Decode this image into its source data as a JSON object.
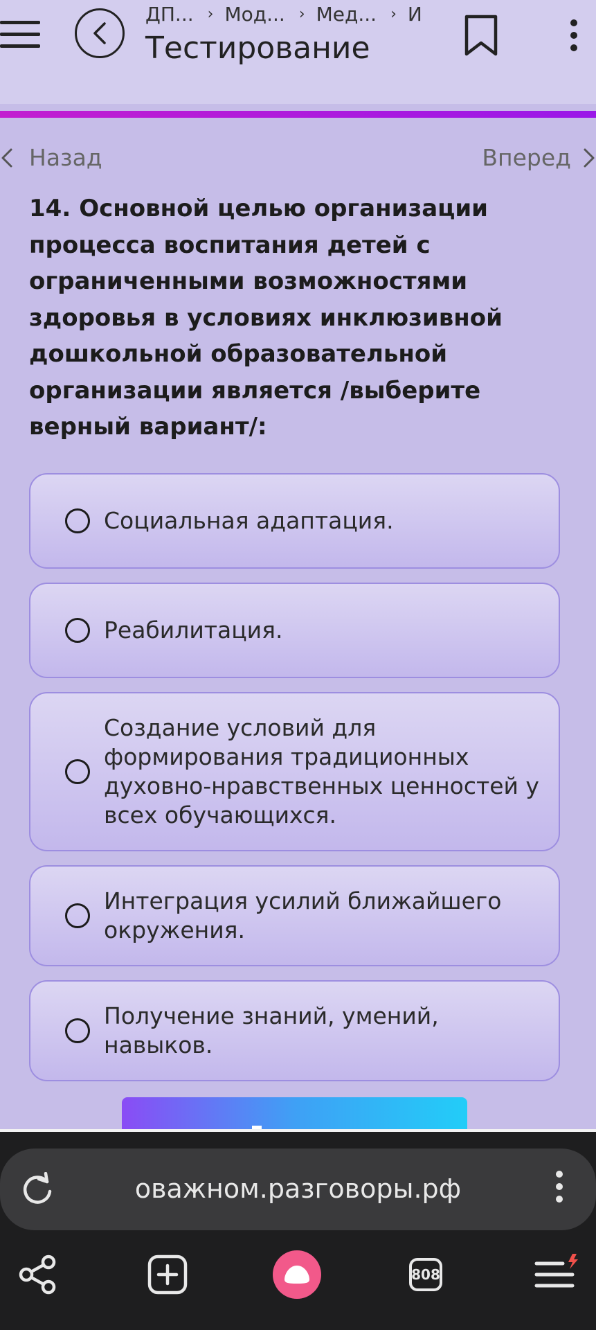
{
  "header": {
    "breadcrumbs": [
      "ДП...",
      "Мод...",
      "Мед...",
      "И"
    ],
    "title": "Тестирование"
  },
  "progress": {
    "fraction": 1.0
  },
  "nav": {
    "back_label": "Назад",
    "forward_label": "Вперед"
  },
  "question": {
    "number": "14.",
    "text": "Основной целью организации процесса воспитания детей с ограниченными возможностями здоровья в условиях инклюзивной дошкольной образовательной организации является /выберите верный вариант/:"
  },
  "options": [
    {
      "label": "Социальная адаптация."
    },
    {
      "label": "Реабилитация."
    },
    {
      "label": "Создание условий для формирования традиционных духовно-нравственных ценностей у всех обучающихся."
    },
    {
      "label": "Интеграция усилий ближайшего окружения."
    },
    {
      "label": "Получение знаний, умений, навыков."
    }
  ],
  "browser": {
    "url": "оважном.разговоры.рф",
    "tab_count": "808"
  },
  "colors": {
    "background": "#c6bde8",
    "progress": "#c21fd0",
    "alice_button": "#f2598a"
  }
}
